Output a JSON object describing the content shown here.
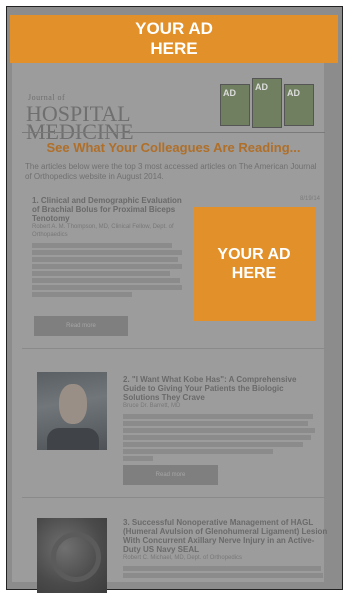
{
  "ads": {
    "top": {
      "line1": "YOUR AD",
      "line2": "HERE"
    },
    "side": {
      "line1": "YOUR AD",
      "line2": "HERE"
    }
  },
  "masthead": {
    "journal": "Journal of",
    "line1": "HOSPITAL",
    "line2": "MEDICINE",
    "cover_labels": [
      "AD",
      "AD",
      "AD"
    ]
  },
  "headline": "See What Your Colleagues Are Reading...",
  "intro": "The articles below were the top 3 most accessed articles on The American Journal of Orthopedics website in August 2014.",
  "articles": [
    {
      "title": "1. Clinical and Demographic Evaluation of Brachial Bolus for Proximal Biceps Tenotomy",
      "meta": "Robert A. M. Thompson, MD, Clinical Fellow, Dept. of Orthopaedics",
      "date": "8/19/14",
      "read_label": "Read more"
    },
    {
      "title": "2. \"I Want What Kobe Has\": A Comprehensive Guide to Giving Your Patients the Biologic Solutions They Crave",
      "meta": "Bruce Dr. Barrett, MD",
      "read_label": "Read more"
    },
    {
      "title": "3. Successful Nonoperative Management of HAGL (Humeral Avulsion of Glenohumeral Ligament) Lesion With Concurrent Axillary Nerve Injury in an Active-Duty US Navy SEAL",
      "meta": "Robert C. Michael, MD, Dept. of Orthopedics"
    }
  ]
}
